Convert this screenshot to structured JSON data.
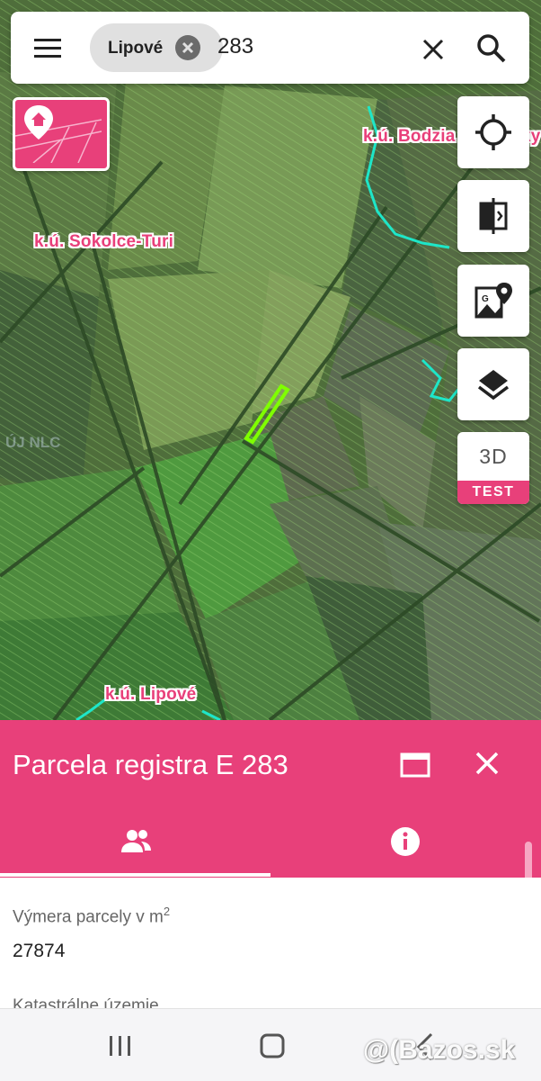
{
  "search": {
    "chip_label": "Lipové",
    "query": "283"
  },
  "icons": {
    "menu": "menu-icon",
    "chip_clear": "cancel-circle-icon",
    "clear": "close-icon",
    "search": "search-icon",
    "map_mode": "map-pin-parcel-icon",
    "locate": "gps-crosshair-icon",
    "compare": "compare-split-icon",
    "google_maps": "google-maps-icon",
    "layers": "layers-icon",
    "window": "window-maximize-icon",
    "close_panel": "close-icon",
    "owners": "people-icon",
    "info": "info-icon",
    "nav_recent": "recent-apps-icon",
    "nav_home": "home-icon",
    "nav_back": "back-icon"
  },
  "map": {
    "labels": {
      "bodzia": "k.ú. Bodzia",
      "bodzia_trailing": "ky",
      "sokolce": "k.ú. Sokolce-Turi",
      "lipove": "k.ú. Lipové"
    },
    "faint_overlay": "ÚJ NLC"
  },
  "side_buttons": {
    "three_d_label": "3D",
    "three_d_badge": "TEST"
  },
  "panel": {
    "title": "Parcela registra E 283",
    "active_tab": "owners",
    "fields": [
      {
        "label": "Výmera parcely v m",
        "superscript": "2",
        "value": "27874"
      },
      {
        "label": "Katastrálne územie",
        "value": ""
      }
    ]
  },
  "watermark": "@(Bazos.sk",
  "colors": {
    "accent": "#e8407a",
    "parcel_highlight": "#7fff00",
    "boundary": "#1ee6c8"
  }
}
